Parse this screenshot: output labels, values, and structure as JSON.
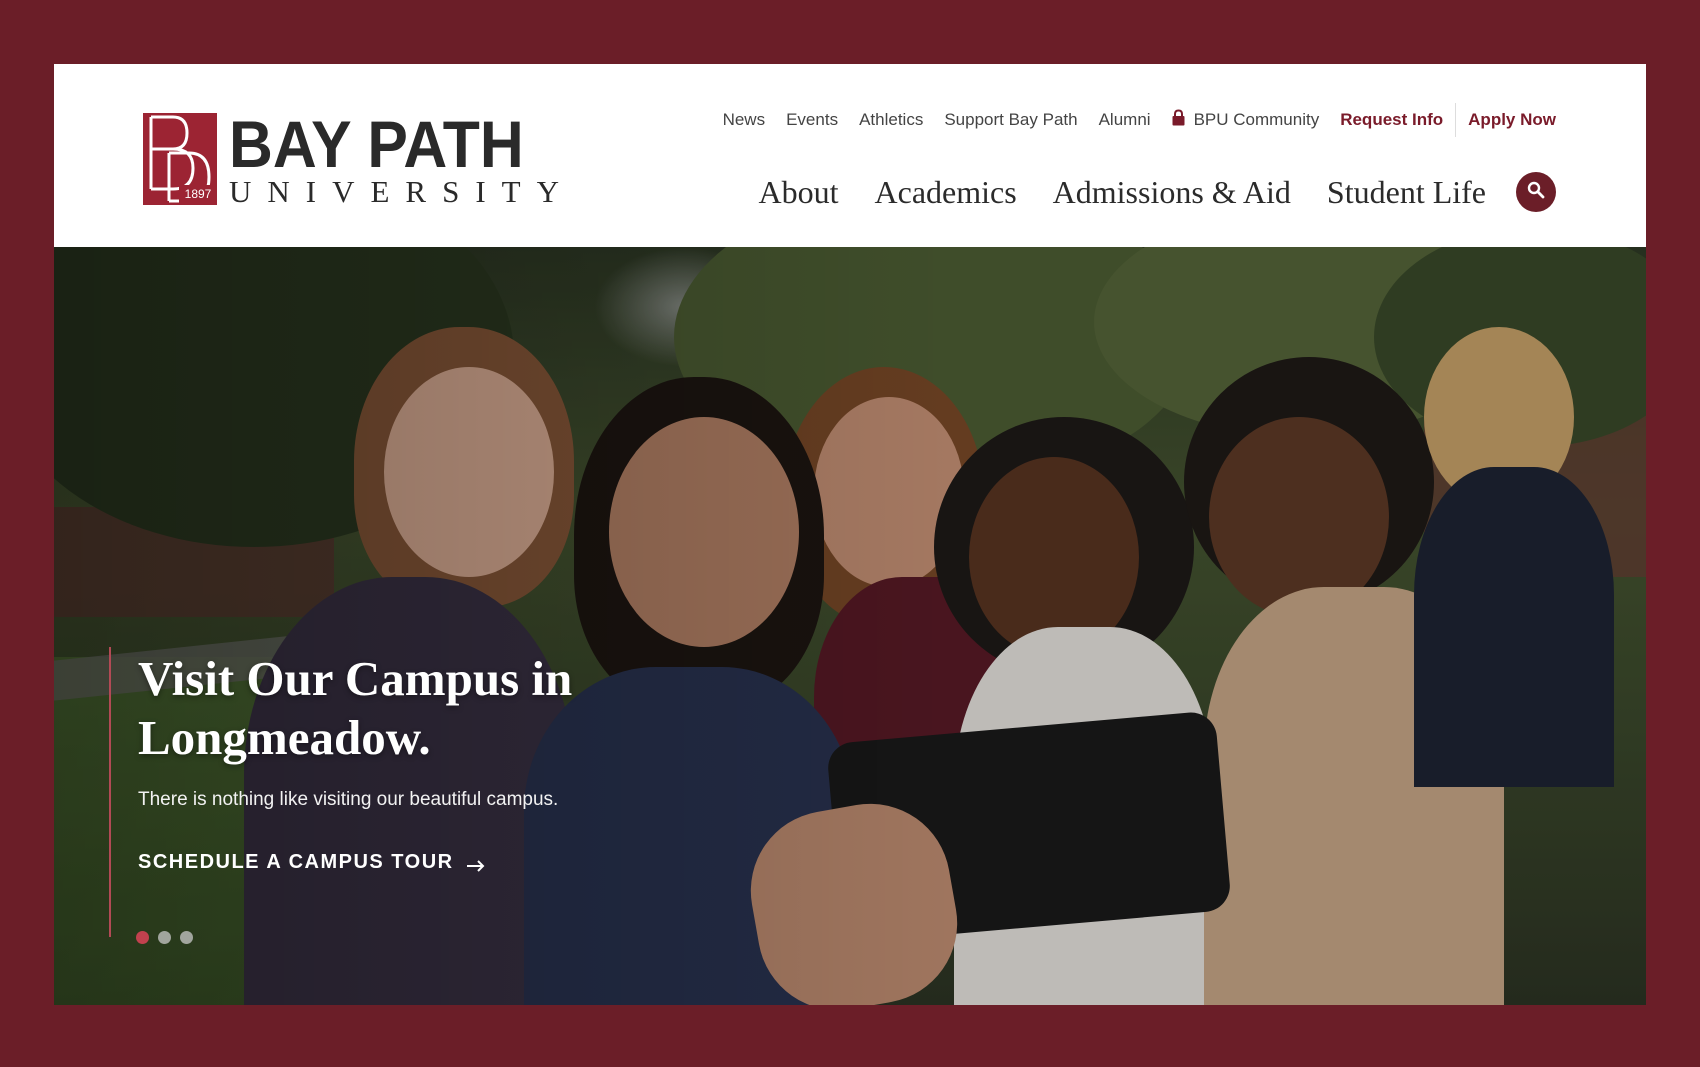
{
  "brand": {
    "name": "BAY PATH",
    "subtitle": "UNIVERSITY",
    "year": "1897",
    "color": "#7a1b2a"
  },
  "utility_nav": {
    "items": [
      "News",
      "Events",
      "Athletics",
      "Support Bay Path",
      "Alumni"
    ],
    "community": "BPU Community",
    "request_info": "Request Info",
    "apply_now": "Apply Now"
  },
  "main_nav": {
    "items": [
      "About",
      "Academics",
      "Admissions & Aid",
      "Student Life"
    ],
    "search_icon": "search-icon"
  },
  "hero": {
    "title_line1": "Visit Our Campus in",
    "title_line2": "Longmeadow.",
    "text": "There is nothing like visiting our beautiful campus.",
    "cta": "SCHEDULE A CAMPUS TOUR",
    "slides_total": 3,
    "active_slide": 1
  },
  "colors": {
    "page_bg": "#6b1e28",
    "accent": "#7a1b2a",
    "dot_active": "#c2414e"
  }
}
